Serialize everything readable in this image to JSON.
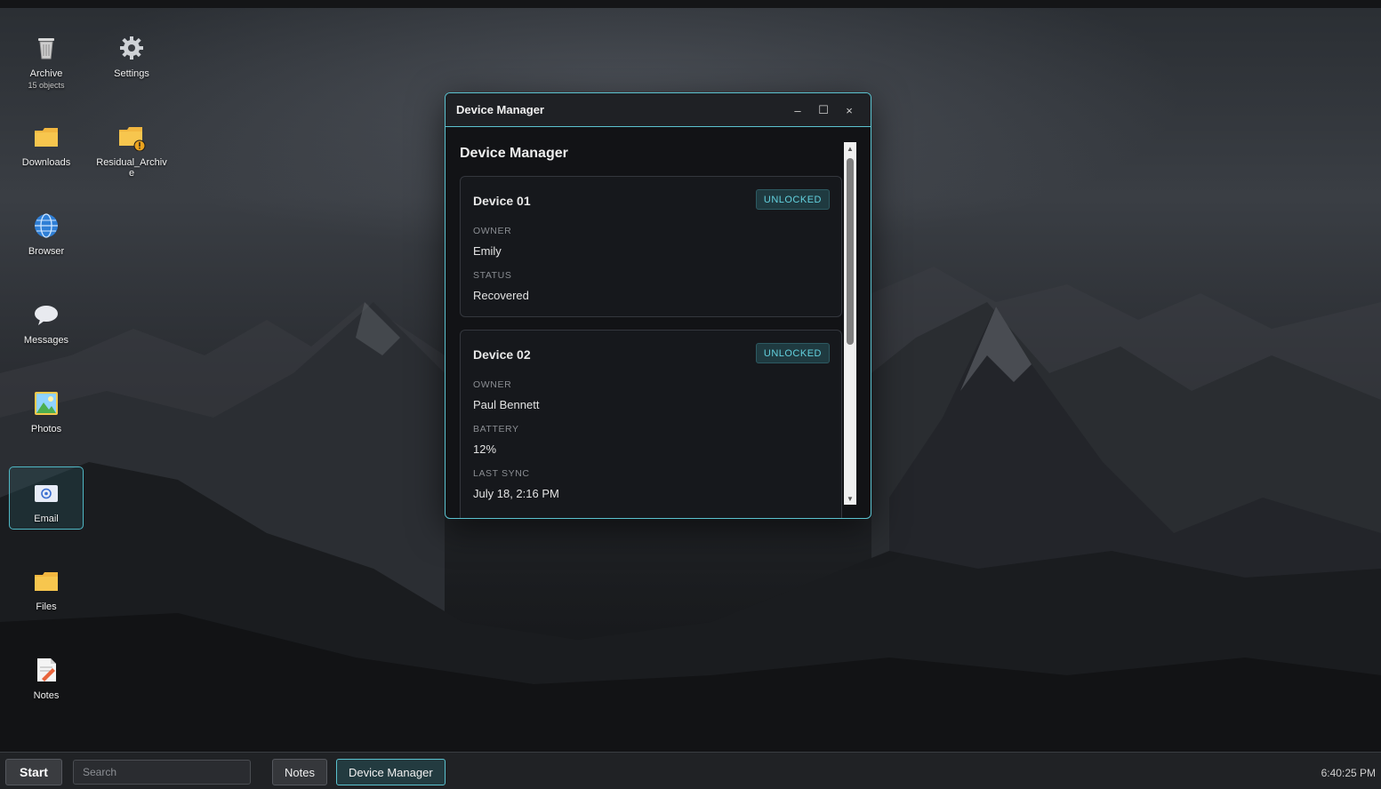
{
  "desktop": {
    "icons": [
      {
        "label": "Archive",
        "sublabel": "15 objects",
        "icon": "trash-icon"
      },
      {
        "label": "Settings",
        "icon": "gear-icon"
      },
      {
        "label": "Downloads",
        "icon": "folder-icon"
      },
      {
        "label": "Residual_Archive",
        "icon": "folder-warning-icon"
      },
      {
        "label": "Browser",
        "icon": "globe-icon"
      },
      {
        "label": "Messages",
        "icon": "chat-bubble-icon"
      },
      {
        "label": "Photos",
        "icon": "image-icon"
      },
      {
        "label": "Email",
        "icon": "email-icon",
        "selected": true
      },
      {
        "label": "Files",
        "icon": "folder-icon"
      },
      {
        "label": "Notes",
        "icon": "notes-icon"
      }
    ]
  },
  "window": {
    "title": "Device Manager",
    "heading": "Device Manager",
    "controls": {
      "minimize": "–",
      "maximize": "☐",
      "close": "×"
    },
    "devices": [
      {
        "name": "Device 01",
        "badge": "UNLOCKED",
        "fields": [
          {
            "label": "OWNER",
            "value": "Emily"
          },
          {
            "label": "STATUS",
            "value": "Recovered"
          }
        ]
      },
      {
        "name": "Device 02",
        "badge": "UNLOCKED",
        "fields": [
          {
            "label": "OWNER",
            "value": "Paul Bennett"
          },
          {
            "label": "BATTERY",
            "value": "12%"
          },
          {
            "label": "LAST SYNC",
            "value": "July 18, 2:16 PM"
          }
        ]
      }
    ]
  },
  "taskbar": {
    "start_label": "Start",
    "search_placeholder": "Search",
    "tasks": [
      {
        "label": "Notes",
        "active": false
      },
      {
        "label": "Device Manager",
        "active": true
      }
    ],
    "clock": "6:40:25 PM"
  },
  "colors": {
    "accent": "#5bc2cf",
    "badge_text": "#63d1de"
  }
}
